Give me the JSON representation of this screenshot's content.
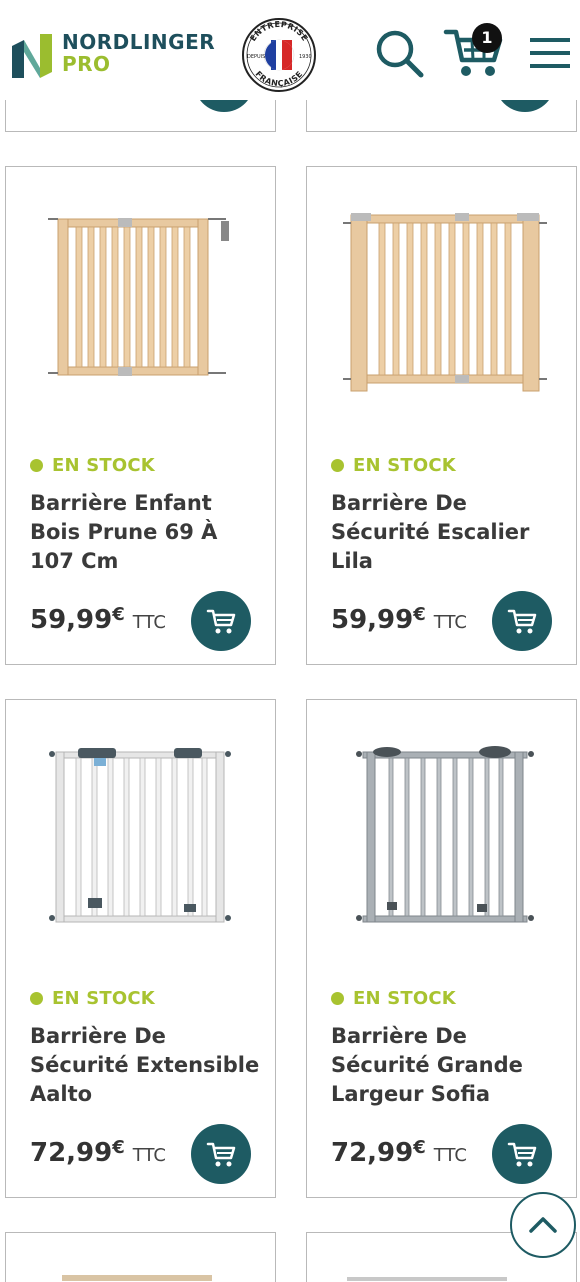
{
  "brand": {
    "name_line1": "NORDLINGER",
    "name_line2": "PRO",
    "badge_top": "ENTREPRISE",
    "badge_bottom": "FRANÇAISE",
    "badge_left": "DEPUIS",
    "badge_right": "1930"
  },
  "header": {
    "cart_count": "1",
    "icons": [
      "search-icon",
      "cart-icon",
      "menu-icon"
    ]
  },
  "colors": {
    "primary": "#1e5b63",
    "accent_green": "#a8c330",
    "logo_navy": "#1e4f5c"
  },
  "products": [
    {
      "status": "EN STOCK",
      "name": "Barrière Enfant Bois Prune 69 À 107 Cm",
      "price": "59,99",
      "currency": "€",
      "tax_label": "TTC"
    },
    {
      "status": "EN STOCK",
      "name": "Barrière De Sécurité Escalier Lila",
      "price": "59,99",
      "currency": "€",
      "tax_label": "TTC"
    },
    {
      "status": "EN STOCK",
      "name": "Barrière De Sécurité Extensible Aalto",
      "price": "72,99",
      "currency": "€",
      "tax_label": "TTC"
    },
    {
      "status": "EN STOCK",
      "name": "Barrière De Sécurité Grande Largeur Sofia",
      "price": "72,99",
      "currency": "€",
      "tax_label": "TTC"
    }
  ]
}
